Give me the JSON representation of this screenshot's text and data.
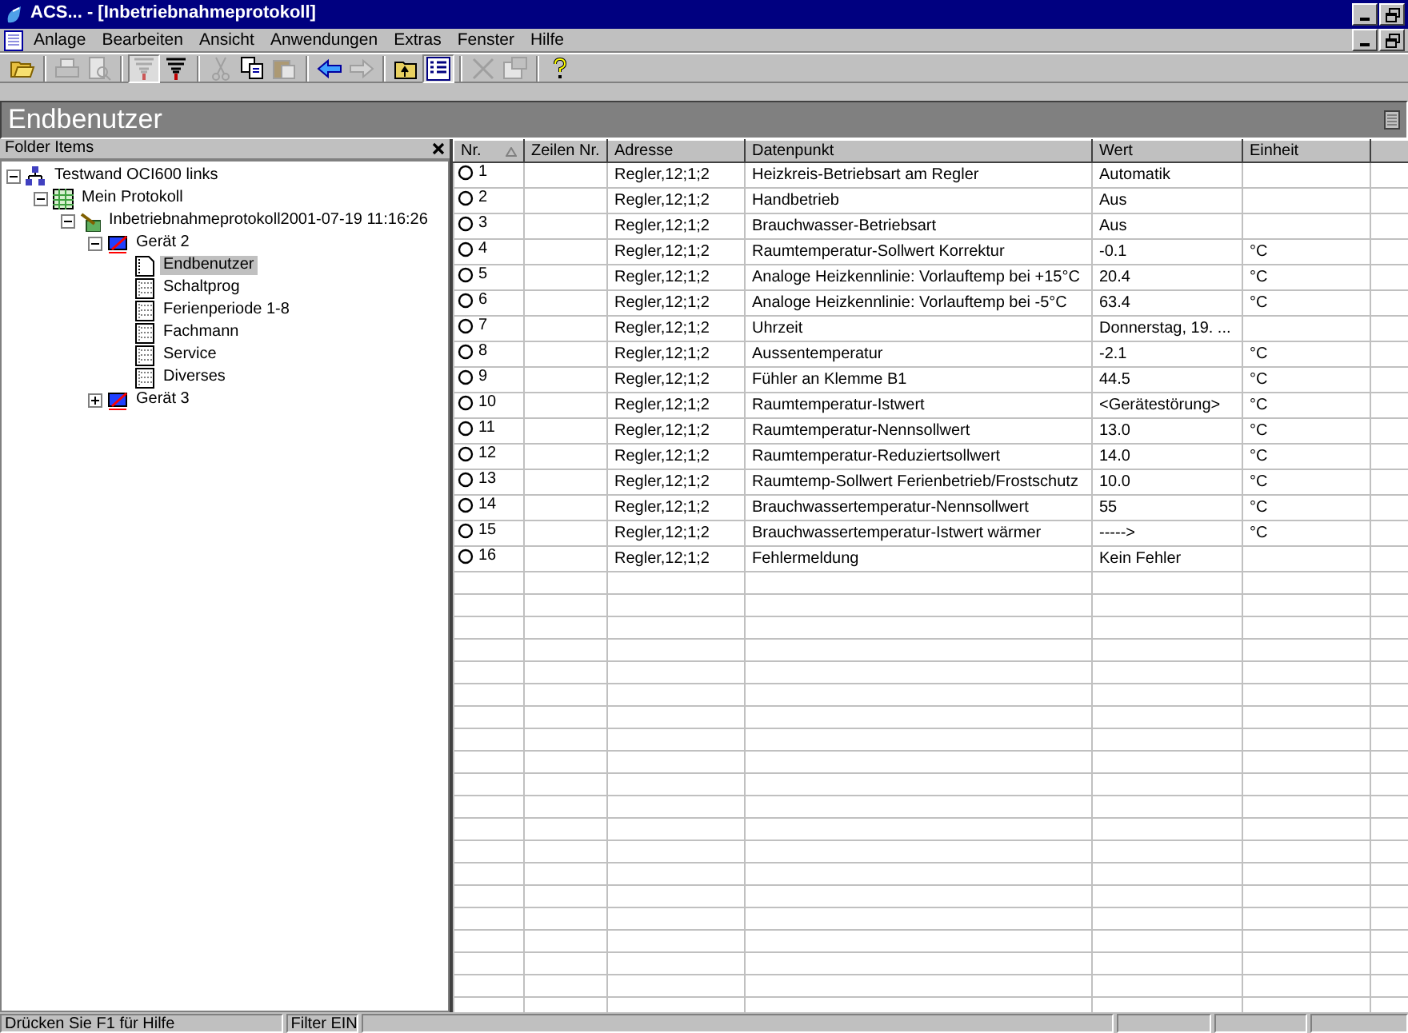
{
  "window": {
    "title": "ACS... - [Inbetriebnahmeprotokoll]"
  },
  "menu": [
    "Anlage",
    "Bearbeiten",
    "Ansicht",
    "Anwendungen",
    "Extras",
    "Fenster",
    "Hilfe"
  ],
  "toolbar": [
    {
      "kind": "open",
      "disabled": false,
      "pressed": false
    },
    {
      "kind": "sep"
    },
    {
      "kind": "print",
      "disabled": true,
      "pressed": false
    },
    {
      "kind": "preview",
      "disabled": true,
      "pressed": false
    },
    {
      "kind": "sep"
    },
    {
      "kind": "filter",
      "disabled": true,
      "pressed": true
    },
    {
      "kind": "filter",
      "disabled": false,
      "pressed": false
    },
    {
      "kind": "sep"
    },
    {
      "kind": "cut",
      "disabled": true,
      "pressed": false
    },
    {
      "kind": "copy",
      "disabled": false,
      "pressed": false
    },
    {
      "kind": "paste",
      "disabled": true,
      "pressed": false
    },
    {
      "kind": "sep"
    },
    {
      "kind": "back",
      "disabled": false,
      "pressed": false
    },
    {
      "kind": "forward",
      "disabled": true,
      "pressed": false
    },
    {
      "kind": "sep"
    },
    {
      "kind": "up",
      "disabled": false,
      "pressed": false
    },
    {
      "kind": "list",
      "disabled": false,
      "pressed": true
    },
    {
      "kind": "sep"
    },
    {
      "kind": "delete",
      "disabled": true,
      "pressed": false
    },
    {
      "kind": "properties",
      "disabled": true,
      "pressed": false
    },
    {
      "kind": "sep"
    },
    {
      "kind": "help",
      "disabled": false,
      "pressed": false
    }
  ],
  "view_title": "Endbenutzer",
  "folder_pane": {
    "title": "Folder Items",
    "tree": [
      {
        "label": "Testwand OCI600 links",
        "kind": "network",
        "expanded": true,
        "selected": false,
        "children": [
          {
            "label": "Mein Protokoll",
            "kind": "grid",
            "expanded": true,
            "selected": false,
            "children": [
              {
                "label": "Inbetriebnahmeprotokoll2001-07-19 11:16:26",
                "kind": "report",
                "expanded": true,
                "selected": false,
                "children": [
                  {
                    "label": "Gerät 2",
                    "kind": "device",
                    "expanded": true,
                    "selected": false,
                    "children": [
                      {
                        "label": "Endbenutzer",
                        "kind": "page",
                        "selected": true
                      },
                      {
                        "label": "Schaltprog",
                        "kind": "grid-page",
                        "selected": false
                      },
                      {
                        "label": "Ferienperiode 1-8",
                        "kind": "grid-page",
                        "selected": false
                      },
                      {
                        "label": "Fachmann",
                        "kind": "grid-page",
                        "selected": false
                      },
                      {
                        "label": "Service",
                        "kind": "grid-page",
                        "selected": false
                      },
                      {
                        "label": "Diverses",
                        "kind": "grid-page",
                        "selected": false
                      }
                    ]
                  },
                  {
                    "label": "Gerät 3",
                    "kind": "device",
                    "expanded": false,
                    "selected": false
                  }
                ]
              }
            ]
          }
        ]
      }
    ]
  },
  "table": {
    "columns": [
      {
        "label": "Nr.",
        "sorted": true
      },
      {
        "label": "Zeilen Nr.",
        "sorted": false
      },
      {
        "label": "Adresse",
        "sorted": false
      },
      {
        "label": "Datenpunkt",
        "sorted": false
      },
      {
        "label": "Wert",
        "sorted": false
      },
      {
        "label": "Einheit",
        "sorted": false
      }
    ],
    "rows": [
      {
        "nr": "1",
        "zeile": "",
        "adresse": "Regler,12;1;2",
        "datenpunkt": "Heizkreis-Betriebsart am Regler",
        "wert": "Automatik",
        "einheit": ""
      },
      {
        "nr": "2",
        "zeile": "",
        "adresse": "Regler,12;1;2",
        "datenpunkt": "Handbetrieb",
        "wert": "Aus",
        "einheit": ""
      },
      {
        "nr": "3",
        "zeile": "",
        "adresse": "Regler,12;1;2",
        "datenpunkt": "Brauchwasser-Betriebsart",
        "wert": "Aus",
        "einheit": ""
      },
      {
        "nr": "4",
        "zeile": "",
        "adresse": "Regler,12;1;2",
        "datenpunkt": "Raumtemperatur-Sollwert Korrektur",
        "wert": "-0.1",
        "einheit": "°C"
      },
      {
        "nr": "5",
        "zeile": "",
        "adresse": "Regler,12;1;2",
        "datenpunkt": "Analoge Heizkennlinie: Vorlauftemp bei +15°C",
        "wert": "20.4",
        "einheit": "°C"
      },
      {
        "nr": "6",
        "zeile": "",
        "adresse": "Regler,12;1;2",
        "datenpunkt": "Analoge Heizkennlinie: Vorlauftemp bei -5°C",
        "wert": "63.4",
        "einheit": "°C"
      },
      {
        "nr": "7",
        "zeile": "",
        "adresse": "Regler,12;1;2",
        "datenpunkt": "Uhrzeit",
        "wert": "Donnerstag, 19. ...",
        "einheit": ""
      },
      {
        "nr": "8",
        "zeile": "",
        "adresse": "Regler,12;1;2",
        "datenpunkt": "Aussentemperatur",
        "wert": "-2.1",
        "einheit": "°C"
      },
      {
        "nr": "9",
        "zeile": "",
        "adresse": "Regler,12;1;2",
        "datenpunkt": "Fühler an Klemme B1",
        "wert": "44.5",
        "einheit": "°C"
      },
      {
        "nr": "10",
        "zeile": "",
        "adresse": "Regler,12;1;2",
        "datenpunkt": "Raumtemperatur-Istwert",
        "wert": "<Gerätestörung>",
        "einheit": "°C"
      },
      {
        "nr": "11",
        "zeile": "",
        "adresse": "Regler,12;1;2",
        "datenpunkt": "Raumtemperatur-Nennsollwert",
        "wert": "13.0",
        "einheit": "°C"
      },
      {
        "nr": "12",
        "zeile": "",
        "adresse": "Regler,12;1;2",
        "datenpunkt": "Raumtemperatur-Reduziertsollwert",
        "wert": "14.0",
        "einheit": "°C"
      },
      {
        "nr": "13",
        "zeile": "",
        "adresse": "Regler,12;1;2",
        "datenpunkt": "Raumtemp-Sollwert Ferienbetrieb/Frostschutz",
        "wert": "10.0",
        "einheit": "°C"
      },
      {
        "nr": "14",
        "zeile": "",
        "adresse": "Regler,12;1;2",
        "datenpunkt": "Brauchwassertemperatur-Nennsollwert",
        "wert": "55",
        "einheit": "°C"
      },
      {
        "nr": "15",
        "zeile": "",
        "adresse": "Regler,12;1;2",
        "datenpunkt": "Brauchwassertemperatur-Istwert wärmer",
        "wert": "----->",
        "einheit": "°C"
      },
      {
        "nr": "16",
        "zeile": "",
        "adresse": "Regler,12;1;2",
        "datenpunkt": "Fehlermeldung",
        "wert": "Kein Fehler",
        "einheit": ""
      }
    ]
  },
  "status_bar": [
    "Drücken Sie F1 für Hilfe",
    "Filter EIN"
  ]
}
